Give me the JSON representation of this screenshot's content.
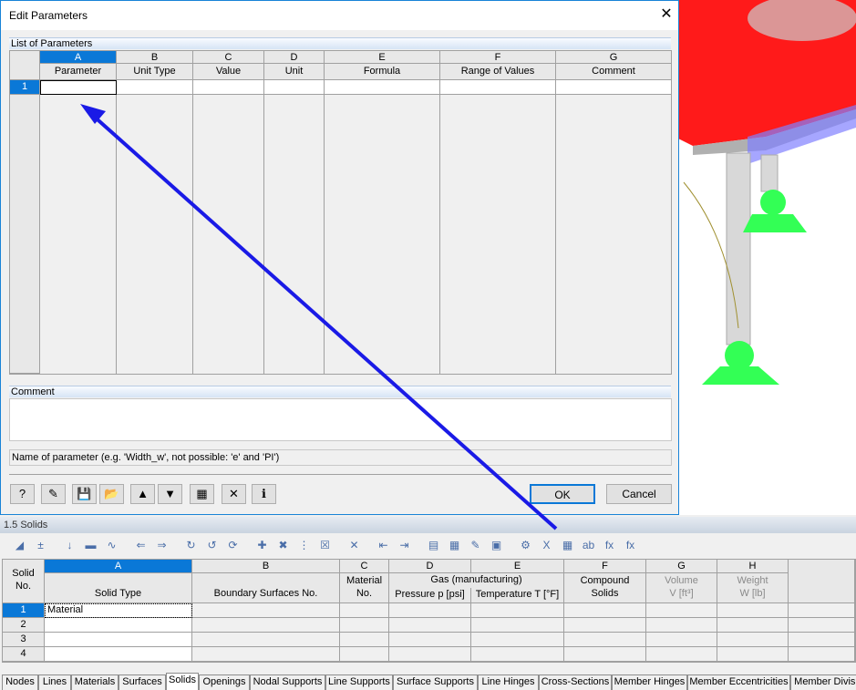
{
  "dialog": {
    "title": "Edit Parameters",
    "list_label": "List of Parameters",
    "columns": [
      {
        "letter": "A",
        "name": "Parameter"
      },
      {
        "letter": "B",
        "name": "Unit Type"
      },
      {
        "letter": "C",
        "name": "Value"
      },
      {
        "letter": "D",
        "name": "Unit"
      },
      {
        "letter": "E",
        "name": "Formula"
      },
      {
        "letter": "F",
        "name": "Range of Values"
      },
      {
        "letter": "G",
        "name": "Comment"
      }
    ],
    "rows": [
      "1"
    ],
    "comment_label": "Comment",
    "status_text": "Name of parameter (e.g. 'Width_w', not possible: 'e' and 'PI')",
    "tool_buttons": [
      "help-icon",
      "edit-icon",
      "save-icon",
      "open-folder-icon",
      "excel-export-icon",
      "excel-import-icon",
      "calculator-icon",
      "delete-icon",
      "info-icon"
    ],
    "ok_label": "OK",
    "cancel_label": "Cancel"
  },
  "panel": {
    "title": "1.5 Solids",
    "table": {
      "letters": [
        "A",
        "B",
        "C",
        "D",
        "E",
        "F",
        "G",
        "H"
      ],
      "rowhead": "Solid No.",
      "headers": {
        "A": "Solid Type",
        "B": "Boundary Surfaces No.",
        "C1": "Material",
        "C2": "No.",
        "DE": "Gas (manufacturing)",
        "D": "Pressure p [psi]",
        "E": "Temperature T [°F]",
        "F1": "Compound",
        "F2": "Solids",
        "G1": "Volume",
        "G2": "V [ft³]",
        "H1": "Weight",
        "H2": "W [lb]"
      },
      "rows": [
        {
          "no": "1",
          "type": "Material"
        },
        {
          "no": "2",
          "type": ""
        },
        {
          "no": "3",
          "type": ""
        },
        {
          "no": "4",
          "type": ""
        }
      ]
    },
    "tabs": [
      "Nodes",
      "Lines",
      "Materials",
      "Surfaces",
      "Solids",
      "Openings",
      "Nodal Supports",
      "Line Supports",
      "Surface Supports",
      "Line Hinges",
      "Cross-Sections",
      "Member Hinges",
      "Member Eccentricities",
      "Member Divisi"
    ],
    "active_tab": "Solids"
  },
  "colors": {
    "accent": "#0a78d7",
    "arrow": "#1a1ae6",
    "plate": "#ff1a1a",
    "support": "#33ff55"
  }
}
